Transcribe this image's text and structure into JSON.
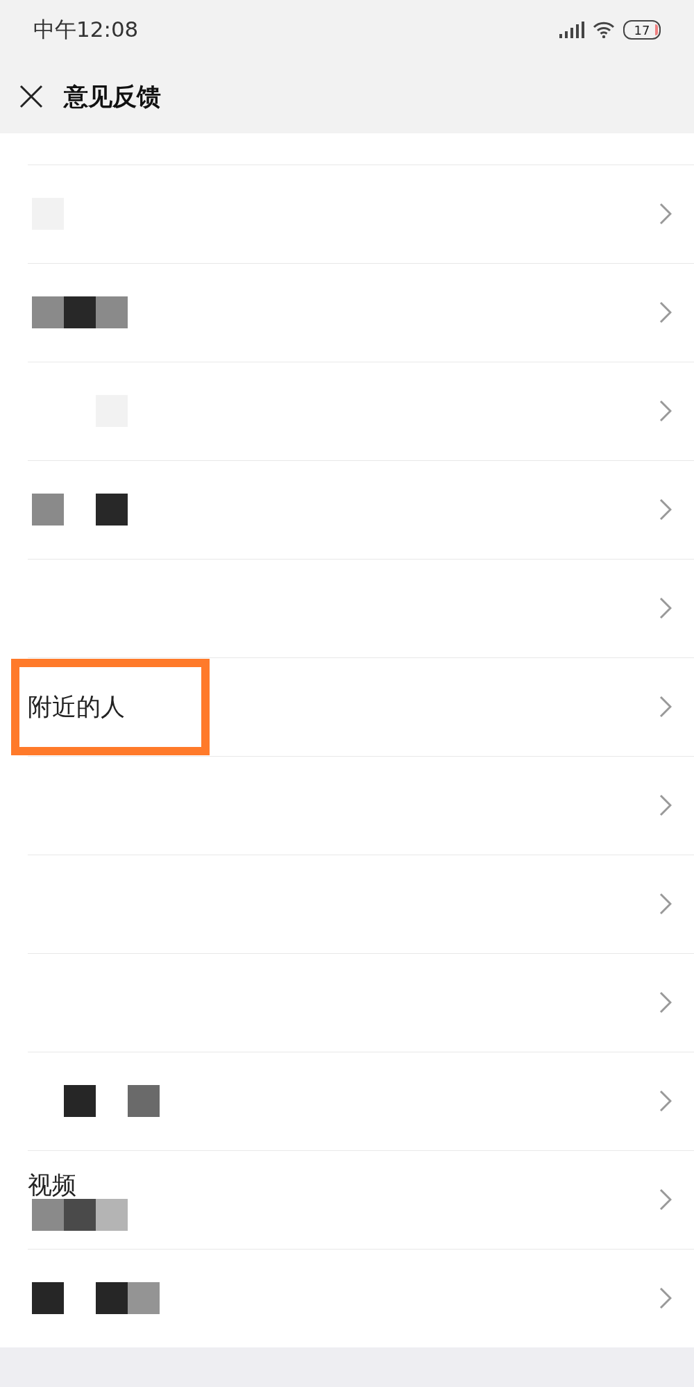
{
  "status_bar": {
    "time": "中午12:08",
    "battery": "17"
  },
  "header": {
    "title": "意见反馈"
  },
  "rows": [
    {
      "highlighted": false,
      "blocks": [
        {
          "color": "#f2f2f2"
        }
      ]
    },
    {
      "highlighted": false,
      "blocks": [
        {
          "color": "#8a8a8a"
        },
        {
          "color": "#282828"
        },
        {
          "color": "#8a8a8a"
        }
      ]
    },
    {
      "highlighted": false,
      "blocks": [
        {
          "kind": "gap"
        },
        {
          "kind": "gap"
        },
        {
          "color": "#f2f2f2"
        }
      ]
    },
    {
      "highlighted": false,
      "blocks": [
        {
          "color": "#8a8a8a"
        },
        {
          "kind": "gap"
        },
        {
          "color": "#282828"
        }
      ]
    },
    {
      "highlighted": false
    },
    {
      "label": "附近的人",
      "highlighted": true
    },
    {
      "highlighted": false
    },
    {
      "highlighted": false
    },
    {
      "highlighted": false
    },
    {
      "highlighted": false,
      "blocks": [
        {
          "kind": "gap"
        },
        {
          "color": "#262626"
        },
        {
          "kind": "gap"
        },
        {
          "color": "#6a6a6a"
        }
      ]
    },
    {
      "label": "视频",
      "highlighted": false,
      "blocks": [
        {
          "color": "#8a8a8a"
        },
        {
          "color": "#4a4a4a"
        },
        {
          "color": "#b4b4b4"
        }
      ]
    },
    {
      "highlighted": false,
      "blocks": [
        {
          "color": "#262626"
        },
        {
          "kind": "gap"
        },
        {
          "color": "#262626"
        },
        {
          "color": "#949494"
        }
      ]
    }
  ]
}
